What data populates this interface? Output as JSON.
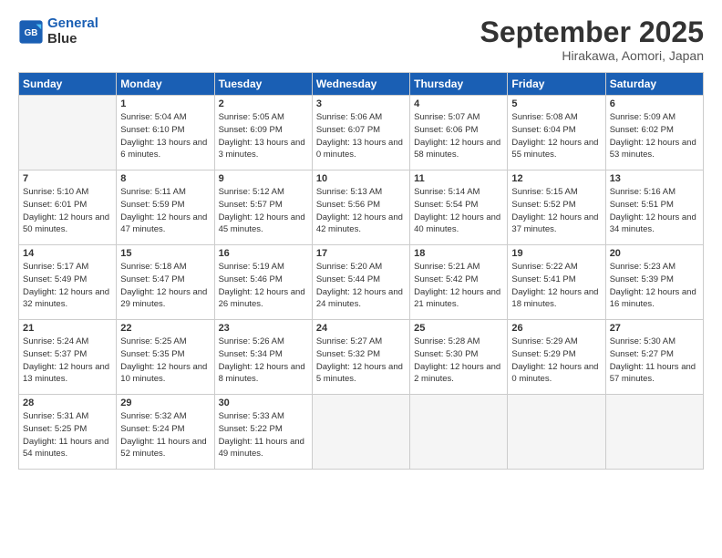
{
  "header": {
    "logo_line1": "General",
    "logo_line2": "Blue",
    "month": "September 2025",
    "location": "Hirakawa, Aomori, Japan"
  },
  "days_of_week": [
    "Sunday",
    "Monday",
    "Tuesday",
    "Wednesday",
    "Thursday",
    "Friday",
    "Saturday"
  ],
  "weeks": [
    [
      {
        "num": "",
        "sunrise": "",
        "sunset": "",
        "daylight": "",
        "empty": true
      },
      {
        "num": "1",
        "sunrise": "Sunrise: 5:04 AM",
        "sunset": "Sunset: 6:10 PM",
        "daylight": "Daylight: 13 hours and 6 minutes."
      },
      {
        "num": "2",
        "sunrise": "Sunrise: 5:05 AM",
        "sunset": "Sunset: 6:09 PM",
        "daylight": "Daylight: 13 hours and 3 minutes."
      },
      {
        "num": "3",
        "sunrise": "Sunrise: 5:06 AM",
        "sunset": "Sunset: 6:07 PM",
        "daylight": "Daylight: 13 hours and 0 minutes."
      },
      {
        "num": "4",
        "sunrise": "Sunrise: 5:07 AM",
        "sunset": "Sunset: 6:06 PM",
        "daylight": "Daylight: 12 hours and 58 minutes."
      },
      {
        "num": "5",
        "sunrise": "Sunrise: 5:08 AM",
        "sunset": "Sunset: 6:04 PM",
        "daylight": "Daylight: 12 hours and 55 minutes."
      },
      {
        "num": "6",
        "sunrise": "Sunrise: 5:09 AM",
        "sunset": "Sunset: 6:02 PM",
        "daylight": "Daylight: 12 hours and 53 minutes."
      }
    ],
    [
      {
        "num": "7",
        "sunrise": "Sunrise: 5:10 AM",
        "sunset": "Sunset: 6:01 PM",
        "daylight": "Daylight: 12 hours and 50 minutes."
      },
      {
        "num": "8",
        "sunrise": "Sunrise: 5:11 AM",
        "sunset": "Sunset: 5:59 PM",
        "daylight": "Daylight: 12 hours and 47 minutes."
      },
      {
        "num": "9",
        "sunrise": "Sunrise: 5:12 AM",
        "sunset": "Sunset: 5:57 PM",
        "daylight": "Daylight: 12 hours and 45 minutes."
      },
      {
        "num": "10",
        "sunrise": "Sunrise: 5:13 AM",
        "sunset": "Sunset: 5:56 PM",
        "daylight": "Daylight: 12 hours and 42 minutes."
      },
      {
        "num": "11",
        "sunrise": "Sunrise: 5:14 AM",
        "sunset": "Sunset: 5:54 PM",
        "daylight": "Daylight: 12 hours and 40 minutes."
      },
      {
        "num": "12",
        "sunrise": "Sunrise: 5:15 AM",
        "sunset": "Sunset: 5:52 PM",
        "daylight": "Daylight: 12 hours and 37 minutes."
      },
      {
        "num": "13",
        "sunrise": "Sunrise: 5:16 AM",
        "sunset": "Sunset: 5:51 PM",
        "daylight": "Daylight: 12 hours and 34 minutes."
      }
    ],
    [
      {
        "num": "14",
        "sunrise": "Sunrise: 5:17 AM",
        "sunset": "Sunset: 5:49 PM",
        "daylight": "Daylight: 12 hours and 32 minutes."
      },
      {
        "num": "15",
        "sunrise": "Sunrise: 5:18 AM",
        "sunset": "Sunset: 5:47 PM",
        "daylight": "Daylight: 12 hours and 29 minutes."
      },
      {
        "num": "16",
        "sunrise": "Sunrise: 5:19 AM",
        "sunset": "Sunset: 5:46 PM",
        "daylight": "Daylight: 12 hours and 26 minutes."
      },
      {
        "num": "17",
        "sunrise": "Sunrise: 5:20 AM",
        "sunset": "Sunset: 5:44 PM",
        "daylight": "Daylight: 12 hours and 24 minutes."
      },
      {
        "num": "18",
        "sunrise": "Sunrise: 5:21 AM",
        "sunset": "Sunset: 5:42 PM",
        "daylight": "Daylight: 12 hours and 21 minutes."
      },
      {
        "num": "19",
        "sunrise": "Sunrise: 5:22 AM",
        "sunset": "Sunset: 5:41 PM",
        "daylight": "Daylight: 12 hours and 18 minutes."
      },
      {
        "num": "20",
        "sunrise": "Sunrise: 5:23 AM",
        "sunset": "Sunset: 5:39 PM",
        "daylight": "Daylight: 12 hours and 16 minutes."
      }
    ],
    [
      {
        "num": "21",
        "sunrise": "Sunrise: 5:24 AM",
        "sunset": "Sunset: 5:37 PM",
        "daylight": "Daylight: 12 hours and 13 minutes."
      },
      {
        "num": "22",
        "sunrise": "Sunrise: 5:25 AM",
        "sunset": "Sunset: 5:35 PM",
        "daylight": "Daylight: 12 hours and 10 minutes."
      },
      {
        "num": "23",
        "sunrise": "Sunrise: 5:26 AM",
        "sunset": "Sunset: 5:34 PM",
        "daylight": "Daylight: 12 hours and 8 minutes."
      },
      {
        "num": "24",
        "sunrise": "Sunrise: 5:27 AM",
        "sunset": "Sunset: 5:32 PM",
        "daylight": "Daylight: 12 hours and 5 minutes."
      },
      {
        "num": "25",
        "sunrise": "Sunrise: 5:28 AM",
        "sunset": "Sunset: 5:30 PM",
        "daylight": "Daylight: 12 hours and 2 minutes."
      },
      {
        "num": "26",
        "sunrise": "Sunrise: 5:29 AM",
        "sunset": "Sunset: 5:29 PM",
        "daylight": "Daylight: 12 hours and 0 minutes."
      },
      {
        "num": "27",
        "sunrise": "Sunrise: 5:30 AM",
        "sunset": "Sunset: 5:27 PM",
        "daylight": "Daylight: 11 hours and 57 minutes."
      }
    ],
    [
      {
        "num": "28",
        "sunrise": "Sunrise: 5:31 AM",
        "sunset": "Sunset: 5:25 PM",
        "daylight": "Daylight: 11 hours and 54 minutes."
      },
      {
        "num": "29",
        "sunrise": "Sunrise: 5:32 AM",
        "sunset": "Sunset: 5:24 PM",
        "daylight": "Daylight: 11 hours and 52 minutes."
      },
      {
        "num": "30",
        "sunrise": "Sunrise: 5:33 AM",
        "sunset": "Sunset: 5:22 PM",
        "daylight": "Daylight: 11 hours and 49 minutes."
      },
      {
        "num": "",
        "sunrise": "",
        "sunset": "",
        "daylight": "",
        "empty": true
      },
      {
        "num": "",
        "sunrise": "",
        "sunset": "",
        "daylight": "",
        "empty": true
      },
      {
        "num": "",
        "sunrise": "",
        "sunset": "",
        "daylight": "",
        "empty": true
      },
      {
        "num": "",
        "sunrise": "",
        "sunset": "",
        "daylight": "",
        "empty": true
      }
    ]
  ]
}
